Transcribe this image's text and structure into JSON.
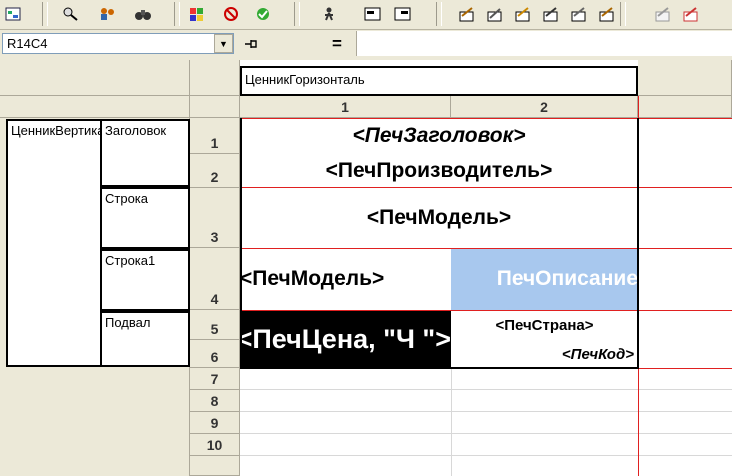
{
  "toolbar": {
    "icons": [
      "report-icon",
      "find-icon",
      "users-icon",
      "binoculars-icon",
      "palette-icon",
      "stop-icon",
      "check-icon",
      "run-icon",
      "form-icon",
      "form2-icon",
      "edit-a-icon",
      "edit-b-icon",
      "edit-c-icon",
      "edit-d-icon",
      "edit-e-icon",
      "edit-f-icon",
      "edit-g-icon",
      "edit-h-icon"
    ]
  },
  "formula_bar": {
    "cell_ref": "R14C4",
    "equals": "="
  },
  "sections": {
    "column_section_label": "ЦенникГоризонталь",
    "row_section_label": "ЦенникВертикаль",
    "items": [
      "Заголовок",
      "Строка",
      "Строка1",
      "Подвал"
    ]
  },
  "columns": [
    "1",
    "2"
  ],
  "rows": [
    "1",
    "2",
    "3",
    "4",
    "5",
    "6",
    "7",
    "8",
    "9",
    "10"
  ],
  "cells": {
    "r1": "<ПечЗаголовок>",
    "r2": "<ПечПроизводитель>",
    "r3": "<ПечМодель>",
    "r4c1": "<ПечМодель>",
    "r4c2": "ПечОписание",
    "r56c1": "<ПечЦена, \"Ч \">",
    "r5c2": "<ПечСтрана>",
    "r6c2": "<ПечКод>"
  },
  "colors": {
    "selection": "#a8c8ee",
    "red_lines": "#e02020",
    "price_bg": "#000000"
  }
}
